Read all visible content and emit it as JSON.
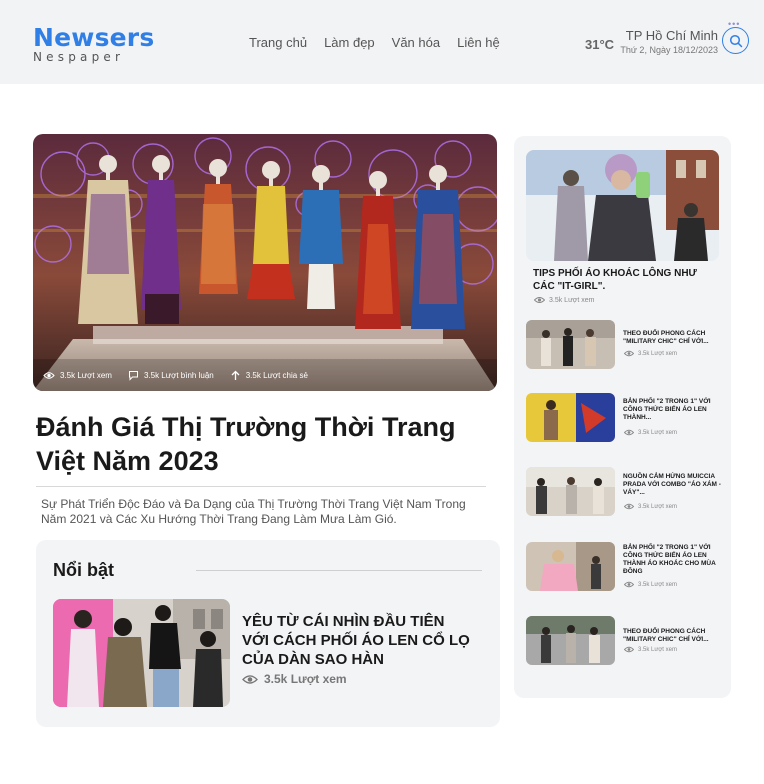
{
  "header": {
    "logo_main": "Newsers",
    "logo_sub": "Nespaper",
    "nav": [
      "Trang chủ",
      "Làm đẹp",
      "Văn hóa",
      "Liên hệ"
    ],
    "temperature": "31°C",
    "city": "TP Hồ Chí Minh",
    "date": "Thứ 2, Ngày 18/12/2023",
    "dots": "•••",
    "search_icon": "search-icon"
  },
  "hero": {
    "stats": {
      "views": "3.5k Lượt xem",
      "comments": "3.5k Lượt bình luận",
      "shares": "3.5k Lượt chia sẻ"
    },
    "title": "Đánh Giá Thị Trường Thời Trang Việt Năm 2023",
    "summary": "Sự Phát Triển Độc Đáo và Đa Dạng của Thị Trường Thời Trang Việt Nam Trong Năm 2021 và Các Xu Hướng Thời Trang Đang Làm Mưa Làm Gió."
  },
  "featured": {
    "heading": "Nổi bật",
    "title": "YÊU TỪ CÁI NHÌN ĐẦU TIÊN VỚI CÁCH PHỐI ÁO LEN CỔ LỌ CỦA DÀN SAO HÀN",
    "views": "3.5k Lượt xem"
  },
  "sidebar": {
    "top": {
      "title": "TIPS PHỐI ÁO KHOÁC LÔNG NHƯ CÁC \"IT-GIRL\".",
      "views": "3.5k Lượt xem"
    },
    "items": [
      {
        "title": "THEO ĐUỔI PHONG CÁCH \"MILITARY CHIC\" CHỈ VỚI...",
        "views": "3.5k Lượt xem"
      },
      {
        "title": "BẢN PHỐI \"2 TRONG 1\" VỚI CÔNG THỨC BIẾN ÁO LEN THÀNH...",
        "views": "3.5k Lượt xem"
      },
      {
        "title": "NGUỒN CẢM HỨNG MUICCIA PRADA VỚI COMBO \"ÁO XÁM - VÁY\"...",
        "views": "3.5k Lượt xem"
      },
      {
        "title": "BẢN PHỐI \"2 TRONG 1\" VỚI CÔNG THỨC BIẾN ÁO LEN THÀNH ÁO KHOÁC CHO MÙA ĐÔNG",
        "views": "3.5k Lượt xem"
      },
      {
        "title": "THEO ĐUỔI PHONG CÁCH \"MILITARY CHIC\" CHỈ VỚI...",
        "views": "3.5k Lượt xem"
      }
    ]
  },
  "colors": {
    "brand": "#2f7fe6",
    "header_bg": "#f2f3f5",
    "card_bg": "#f3f4f6"
  }
}
